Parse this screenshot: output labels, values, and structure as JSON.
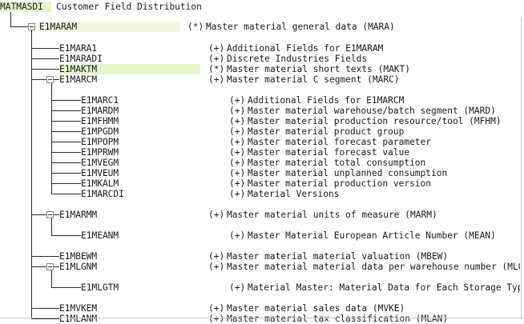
{
  "header": {
    "idoc_type": "MATMASDI",
    "title": "Customer Field Distribution"
  },
  "tree": {
    "root": {
      "segment": "E1MARAM",
      "status": "(*)",
      "description": "Master material general data (MARA)"
    },
    "items": [
      {
        "segment": "E1MARA1",
        "status": "(+)",
        "description": "Additional Fields for E1MARAM"
      },
      {
        "segment": "E1MARADI",
        "status": "(+)",
        "description": "Discrete Industries Fields"
      },
      {
        "segment": "E1MAKTM",
        "status": "(*)",
        "description": "Master material short texts (MAKT)",
        "selected": true
      },
      {
        "segment": "E1MARCM",
        "status": "(+)",
        "description": "Master material C segment (MARC)",
        "expanded": true
      },
      {
        "segment": "E1MARC1",
        "status": "(+)",
        "description": "Additional Fields for E1MARCM"
      },
      {
        "segment": "E1MARDM",
        "status": "(+)",
        "description": "Master material warehouse/batch segment (MARD)"
      },
      {
        "segment": "E1MFHMM",
        "status": "(+)",
        "description": "Master material production resource/tool (MFHM)"
      },
      {
        "segment": "E1MPGDM",
        "status": "(+)",
        "description": "Master material product group"
      },
      {
        "segment": "E1MPOPM",
        "status": "(+)",
        "description": "Master material forecast parameter"
      },
      {
        "segment": "E1MPRWM",
        "status": "(+)",
        "description": "Master material forecast value"
      },
      {
        "segment": "E1MVEGM",
        "status": "(+)",
        "description": "Master material total consumption"
      },
      {
        "segment": "E1MVEUM",
        "status": "(+)",
        "description": "Master material unplanned consumption"
      },
      {
        "segment": "E1MKALM",
        "status": "(+)",
        "description": "Master material production version"
      },
      {
        "segment": "E1MARCDI",
        "status": "(+)",
        "description": "Material Versions"
      },
      {
        "segment": "E1MARMM",
        "status": "(+)",
        "description": "Master material units of measure (MARM)",
        "expanded": true
      },
      {
        "segment": "E1MEANM",
        "status": "(+)",
        "description": "Master Material European Article Number (MEAN)"
      },
      {
        "segment": "E1MBEWM",
        "status": "(+)",
        "description": "Master material material valuation (MBEW)"
      },
      {
        "segment": "E1MLGNM",
        "status": "(+)",
        "description": "Master material material data per warehouse number (MLGN",
        "expanded": true
      },
      {
        "segment": "E1MLGTM",
        "status": "(+)",
        "description": "Material Master: Material Data for Each Storage Type"
      },
      {
        "segment": "E1MVKEM",
        "status": "(+)",
        "description": "Master material sales data (MVKE)"
      },
      {
        "segment": "E1MLANM",
        "status": "(+)",
        "description": "Master material tax classification (MLAN)"
      }
    ]
  },
  "colors": {
    "selection": "#e6f6cc",
    "root_highlight": "#f0f7e0",
    "lines": "#2a2a2a"
  },
  "icons": {
    "expand_toggle": "collapse-minus-icon"
  }
}
